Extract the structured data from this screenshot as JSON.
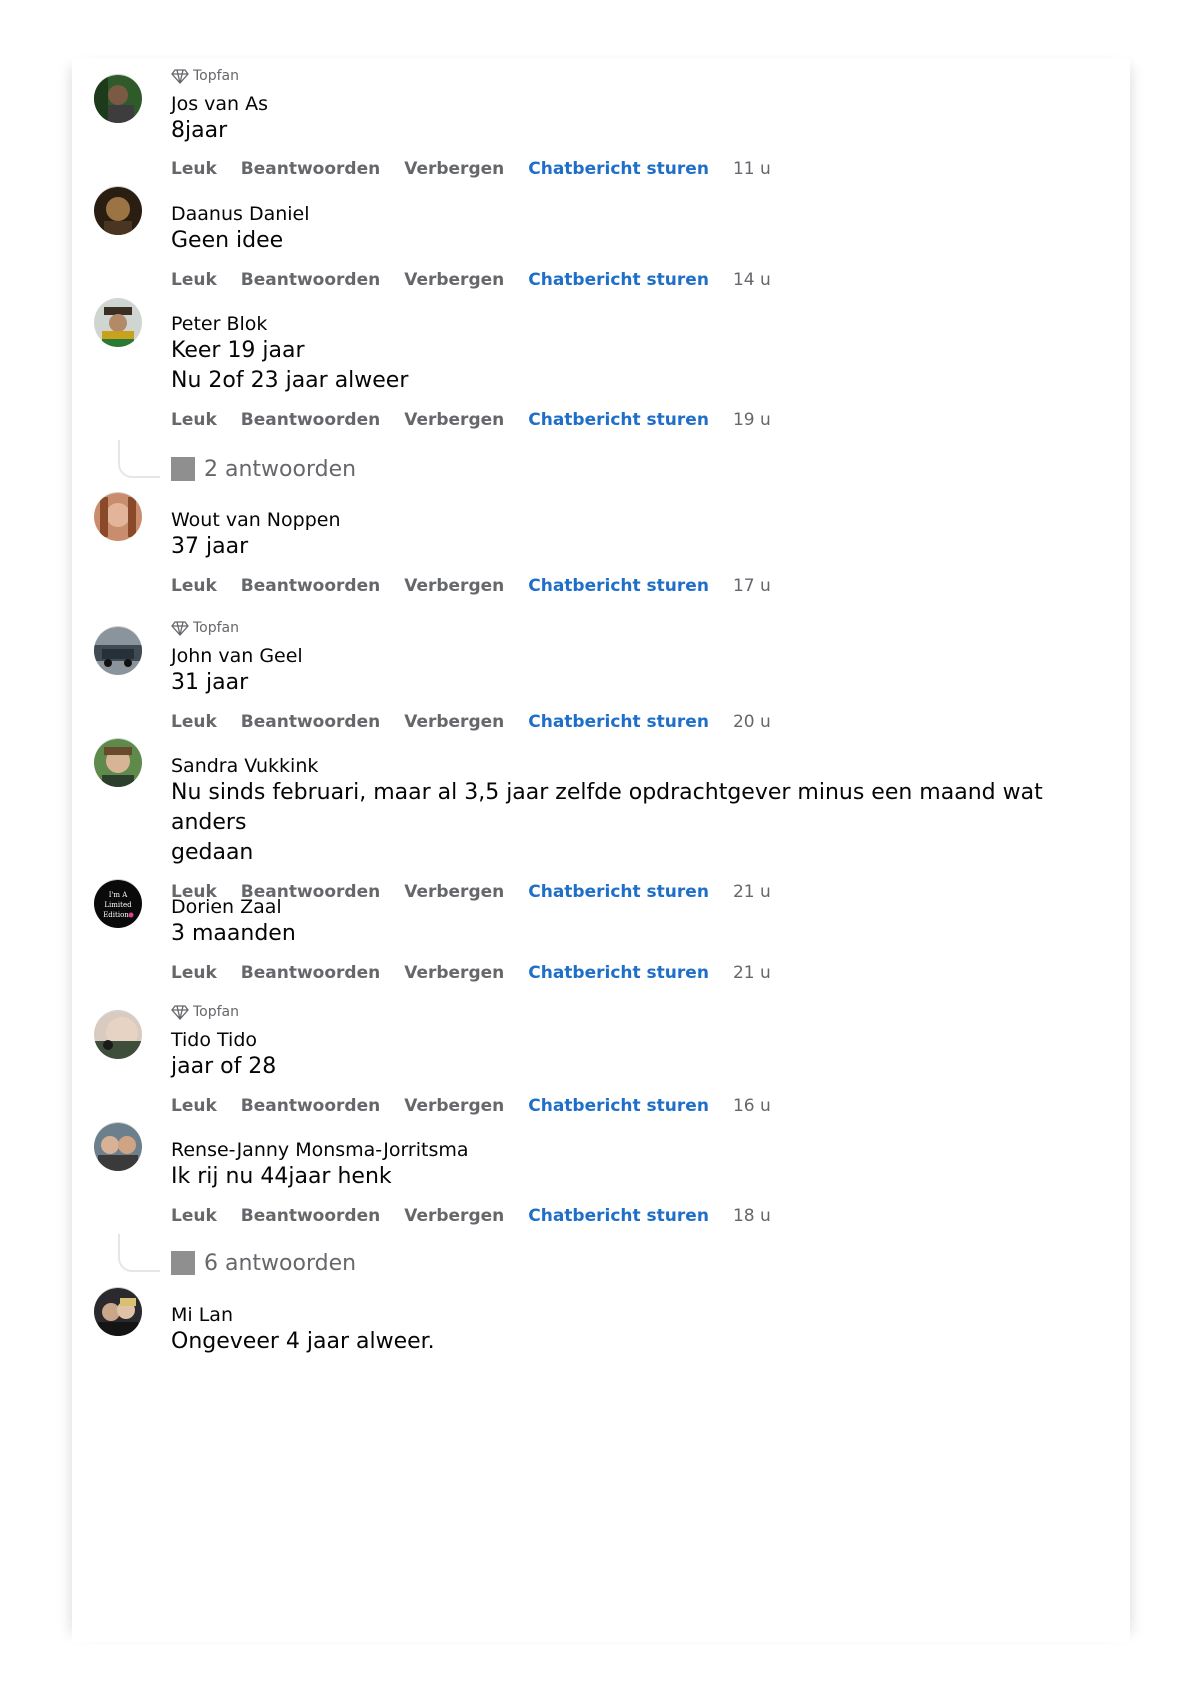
{
  "labels": {
    "topfan": "Topfan",
    "like": "Leuk",
    "reply": "Beantwoorden",
    "hide": "Verbergen",
    "chat": "Chatbericht sturen"
  },
  "colors": {
    "accent": "#1f6fc9",
    "meta": "#65676b",
    "text": "#050505"
  },
  "comments": [
    {
      "author": "Jos van As",
      "lines": [
        "8jaar"
      ],
      "time": "11 u",
      "topfan": true
    },
    {
      "author": "Daanus Daniel",
      "lines": [
        "Geen idee"
      ],
      "time": "14 u",
      "topfan": false
    },
    {
      "author": "Peter Blok",
      "lines": [
        "Keer 19 jaar",
        "Nu 2of 23 jaar alweer"
      ],
      "time": "19 u",
      "topfan": false,
      "replies": "2 antwoorden"
    },
    {
      "author": "Wout van Noppen",
      "lines": [
        "37 jaar"
      ],
      "time": "17 u",
      "topfan": false
    },
    {
      "author": "John van Geel",
      "lines": [
        "31 jaar"
      ],
      "time": "20 u",
      "topfan": true
    },
    {
      "author": "Sandra Vukkink",
      "lines": [
        "Nu sinds februari, maar al 3,5 jaar zelfde opdrachtgever minus een maand wat anders",
        "gedaan"
      ],
      "time": "21 u",
      "topfan": false
    },
    {
      "author": "Dorien Zaal",
      "lines": [
        "3 maanden"
      ],
      "time": "21 u",
      "topfan": false
    },
    {
      "author": "Tido Tido",
      "lines": [
        "jaar of 28"
      ],
      "time": "16 u",
      "topfan": true
    },
    {
      "author": "Rense-Janny Monsma-Jorritsma",
      "lines": [
        "Ik rij nu 44jaar henk"
      ],
      "time": "18 u",
      "topfan": false,
      "replies": "6 antwoorden"
    },
    {
      "author": "Mi Lan",
      "lines": [
        "Ongeveer 4 jaar alweer."
      ],
      "time": "",
      "topfan": false
    }
  ]
}
